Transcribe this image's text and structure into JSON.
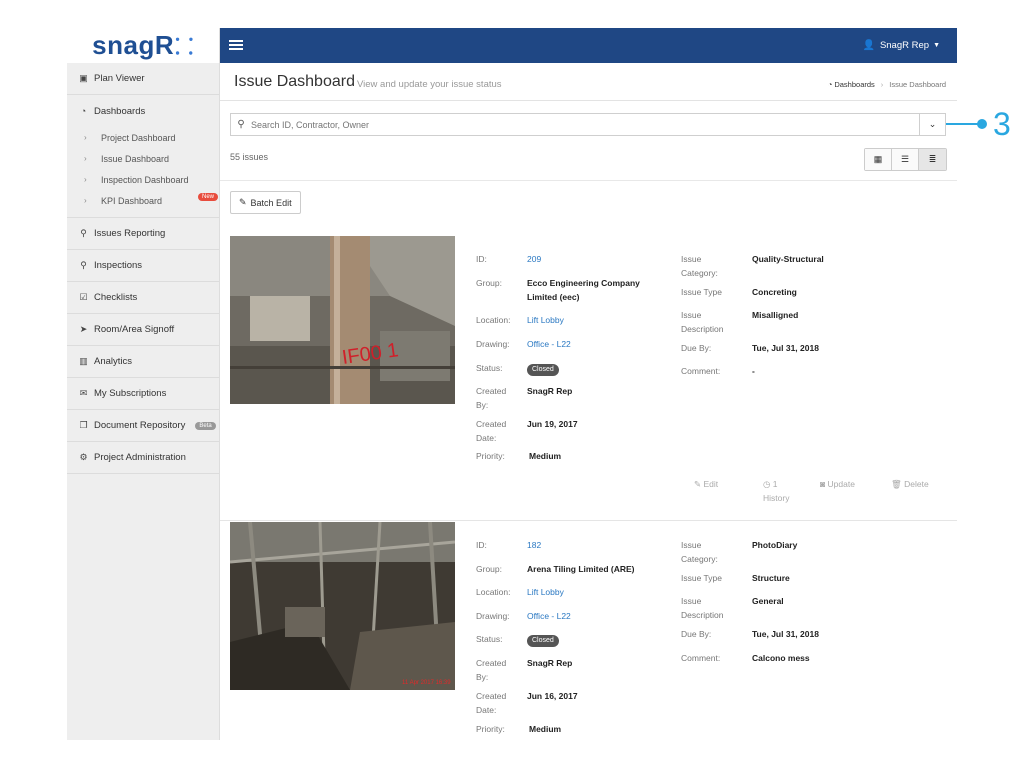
{
  "brand": {
    "name": "snagR"
  },
  "sidebar": {
    "items": [
      {
        "label": "Plan Viewer",
        "icon": "image-icon"
      },
      {
        "label": "Dashboards",
        "icon": "dashboard-icon"
      },
      {
        "label": "Issues Reporting",
        "icon": "map-marker-icon"
      },
      {
        "label": "Inspections",
        "icon": "search-icon"
      },
      {
        "label": "Checklists",
        "icon": "checkbox-icon"
      },
      {
        "label": "Room/Area Signoff",
        "icon": "send-icon"
      },
      {
        "label": "Analytics",
        "icon": "bar-chart-icon"
      },
      {
        "label": "My Subscriptions",
        "icon": "envelope-icon"
      },
      {
        "label": "Document Repository",
        "icon": "documents-icon",
        "badge": "Beta"
      },
      {
        "label": "Project Administration",
        "icon": "gears-icon"
      }
    ],
    "dashboards_sub": [
      {
        "label": "Project Dashboard"
      },
      {
        "label": "Issue Dashboard"
      },
      {
        "label": "Inspection Dashboard"
      },
      {
        "label": "KPI Dashboard",
        "badge": "New"
      }
    ]
  },
  "topbar": {
    "user": "SnagR Rep"
  },
  "header": {
    "title": "Issue Dashboard",
    "subtitle": "View and update your issue status",
    "breadcrumb": [
      "Dashboards",
      "Issue Dashboard"
    ]
  },
  "filter": {
    "search_placeholder": "Search ID, Contractor, Owner",
    "count": "55 issues",
    "batch_edit": "Batch Edit"
  },
  "labels": {
    "id": "ID:",
    "group": "Group:",
    "location": "Location:",
    "drawing": "Drawing:",
    "status": "Status:",
    "created_by_1": "Created",
    "created_by_2": "By:",
    "created_date_1": "Created",
    "created_date_2": "Date:",
    "priority": "Priority:",
    "issue_category_1": "Issue",
    "issue_category_2": "Category:",
    "issue_type": "Issue Type",
    "issue_description_1": "Issue",
    "issue_description_2": "Description",
    "due_by": "Due By:",
    "comment": "Comment:"
  },
  "actions": {
    "edit": "Edit",
    "history_count": "1",
    "history": "History",
    "update": "Update",
    "delete": "Delete"
  },
  "issues": [
    {
      "id": "209",
      "group_line1": "Ecco Engineering Company",
      "group_line2": "Limited  (eec)",
      "location": "Lift Lobby",
      "drawing": "Office - L22",
      "status": "Closed",
      "created_by": "SnagR Rep",
      "created_date": "Jun 19, 2017",
      "priority": "Medium",
      "issue_category": "Quality-Structural",
      "issue_type": "Concreting",
      "issue_description": "Misalligned",
      "due_by": "Tue, Jul 31, 2018",
      "comment": "-",
      "photo_markings": "IF00 1"
    },
    {
      "id": "182",
      "group_line1": "Arena Tiling Limited  (ARE)",
      "location": "Lift Lobby",
      "drawing": "Office - L22",
      "status": "Closed",
      "created_by": "SnagR Rep",
      "created_date": "Jun 16, 2017",
      "priority": "Medium",
      "issue_category": "PhotoDiary",
      "issue_type": "Structure",
      "issue_description": "General",
      "due_by": "Tue, Jul 31, 2018",
      "comment": "Calcono mess",
      "photo_stamp": "11 Apr 2017 16:39"
    }
  ],
  "annotation": {
    "number": "3"
  },
  "colors": {
    "topbar": "#1f4784",
    "brand": "#1f4f93",
    "link": "#2a78c2",
    "annotation": "#2aa7e0",
    "new_badge": "#e84c3d"
  }
}
